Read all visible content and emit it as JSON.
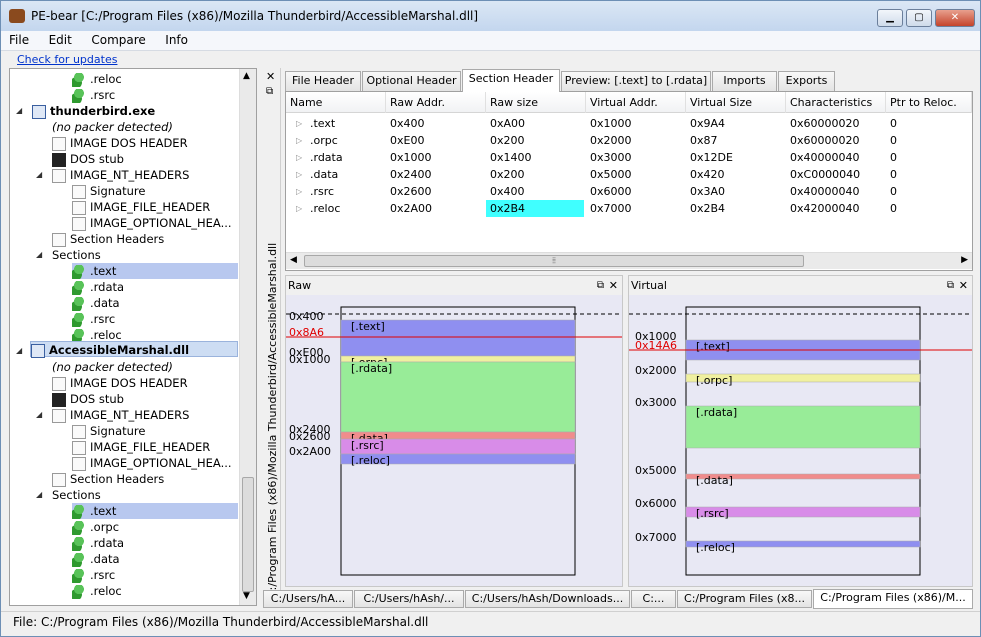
{
  "window": {
    "title": "PE-bear [C:/Program Files (x86)/Mozilla Thunderbird/AccessibleMarshal.dll]"
  },
  "menu": [
    "File",
    "Edit",
    "Compare",
    "Info"
  ],
  "link": "Check for updates",
  "tree": {
    "top_items": [
      ".reloc",
      ".rsrc"
    ],
    "file1": {
      "name": "thunderbird.exe",
      "packer": "(no packer detected)",
      "dos_header": "IMAGE DOS HEADER",
      "dos_stub": "DOS stub",
      "nt_headers": "IMAGE_NT_HEADERS",
      "signature": "Signature",
      "file_header": "IMAGE_FILE_HEADER",
      "optional_header": "IMAGE_OPTIONAL_HEA...",
      "section_headers": "Section Headers",
      "sections_label": "Sections",
      "sections": [
        ".text",
        ".rdata",
        ".data",
        ".rsrc",
        ".reloc"
      ]
    },
    "file2": {
      "name": "AccessibleMarshal.dll",
      "packer": "(no packer detected)",
      "dos_header": "IMAGE DOS HEADER",
      "dos_stub": "DOS stub",
      "nt_headers": "IMAGE_NT_HEADERS",
      "signature": "Signature",
      "file_header": "IMAGE_FILE_HEADER",
      "optional_header": "IMAGE_OPTIONAL_HEA...",
      "section_headers": "Section Headers",
      "sections_label": "Sections",
      "sections": [
        ".text",
        ".orpc",
        ".rdata",
        ".data",
        ".rsrc",
        ".reloc"
      ]
    }
  },
  "side_path": "C:/Program Files (x86)/Mozilla Thunderbird/AccessibleMarshal.dll",
  "tabs": [
    "File Header",
    "Optional Header",
    "Section Header",
    "Preview: [.text] to [.rdata]",
    "Imports",
    "Exports"
  ],
  "active_tab": "Section Header",
  "table": {
    "columns": [
      "Name",
      "Raw Addr.",
      "Raw size",
      "Virtual Addr.",
      "Virtual Size",
      "Characteristics",
      "Ptr to Reloc."
    ],
    "rows": [
      [
        ".text",
        "0x400",
        "0xA00",
        "0x1000",
        "0x9A4",
        "0x60000020",
        "0"
      ],
      [
        ".orpc",
        "0xE00",
        "0x200",
        "0x2000",
        "0x87",
        "0x60000020",
        "0"
      ],
      [
        ".rdata",
        "0x1000",
        "0x1400",
        "0x3000",
        "0x12DE",
        "0x40000040",
        "0"
      ],
      [
        ".data",
        "0x2400",
        "0x200",
        "0x5000",
        "0x420",
        "0xC0000040",
        "0"
      ],
      [
        ".rsrc",
        "0x2600",
        "0x400",
        "0x6000",
        "0x3A0",
        "0x40000040",
        "0"
      ],
      [
        ".reloc",
        "0x2A00",
        "0x2B4",
        "0x7000",
        "0x2B4",
        "0x42000040",
        "0"
      ]
    ],
    "highlight_color": "#40ffff"
  },
  "raw_panel": {
    "title": "Raw",
    "marker_label": "0x8A6",
    "addr_labels": [
      "0x400",
      "0xE00",
      "0x1000",
      "0x2400",
      "0x2600",
      "0x2A00"
    ],
    "sections": [
      {
        "name": "[.text]",
        "color": "#8f8ff0"
      },
      {
        "name": "[.orpc]",
        "color": "#f0f0a0"
      },
      {
        "name": "[.rdata]",
        "color": "#98ec98"
      },
      {
        "name": "[.data]",
        "color": "#f08c8c"
      },
      {
        "name": "[.rsrc]",
        "color": "#d88ce8"
      },
      {
        "name": "[.reloc]",
        "color": "#8f8ff0"
      }
    ]
  },
  "virtual_panel": {
    "title": "Virtual",
    "marker_label": "0x14A6",
    "addr_labels": [
      "0x1000",
      "0x2000",
      "0x3000",
      "0x5000",
      "0x6000",
      "0x7000"
    ],
    "sections": [
      {
        "name": "[.text]",
        "color": "#8f8ff0"
      },
      {
        "name": "[.orpc]",
        "color": "#f0f0a0"
      },
      {
        "name": "[.rdata]",
        "color": "#98ec98"
      },
      {
        "name": "[.data]",
        "color": "#f08c8c"
      },
      {
        "name": "[.rsrc]",
        "color": "#d88ce8"
      },
      {
        "name": "[.reloc]",
        "color": "#8f8ff0"
      }
    ]
  },
  "bottom_tabs": [
    "C:/Users/hA...",
    "C:/Users/hAsh/...",
    "C:/Users/hAsh/Downloads...",
    "C:...",
    "C:/Program Files (x8...",
    "C:/Program Files (x86)/M..."
  ],
  "status": "File: C:/Program Files (x86)/Mozilla Thunderbird/AccessibleMarshal.dll",
  "colors": {
    "marker_line": "#e00000",
    "selection": "#b8c8ef"
  }
}
